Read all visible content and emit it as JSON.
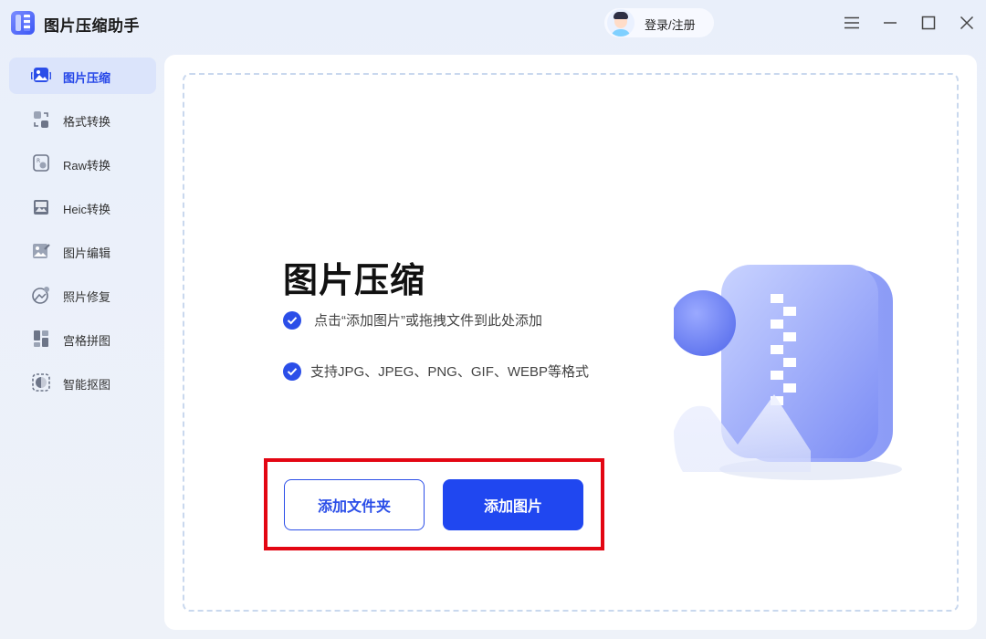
{
  "app": {
    "title": "图片压缩助手"
  },
  "header": {
    "login_label": "登录/注册"
  },
  "window_controls": [
    "menu-icon",
    "minimize-icon",
    "maximize-icon",
    "close-icon"
  ],
  "sidebar": {
    "items": [
      {
        "label": "图片压缩",
        "icon": "image-compress-icon",
        "active": true
      },
      {
        "label": "格式转换",
        "icon": "format-convert-icon",
        "active": false
      },
      {
        "label": "Raw转换",
        "icon": "raw-convert-icon",
        "active": false
      },
      {
        "label": "Heic转换",
        "icon": "heic-convert-icon",
        "active": false
      },
      {
        "label": "图片编辑",
        "icon": "image-edit-icon",
        "active": false
      },
      {
        "label": "照片修复",
        "icon": "photo-repair-icon",
        "active": false
      },
      {
        "label": "宫格拼图",
        "icon": "grid-collage-icon",
        "active": false
      },
      {
        "label": "智能抠图",
        "icon": "smart-cutout-icon",
        "active": false
      }
    ]
  },
  "main": {
    "title": "图片压缩",
    "features": [
      "点击“添加图片”或拖拽文件到此处添加",
      "支持JPG、JPEG、PNG、GIF、WEBP等格式"
    ],
    "add_folder_label": "添加文件夹",
    "add_image_label": "添加图片"
  },
  "colors": {
    "accent": "#2047f0",
    "active_nav_bg": "#dbe4fb",
    "highlight": "#e30613"
  }
}
